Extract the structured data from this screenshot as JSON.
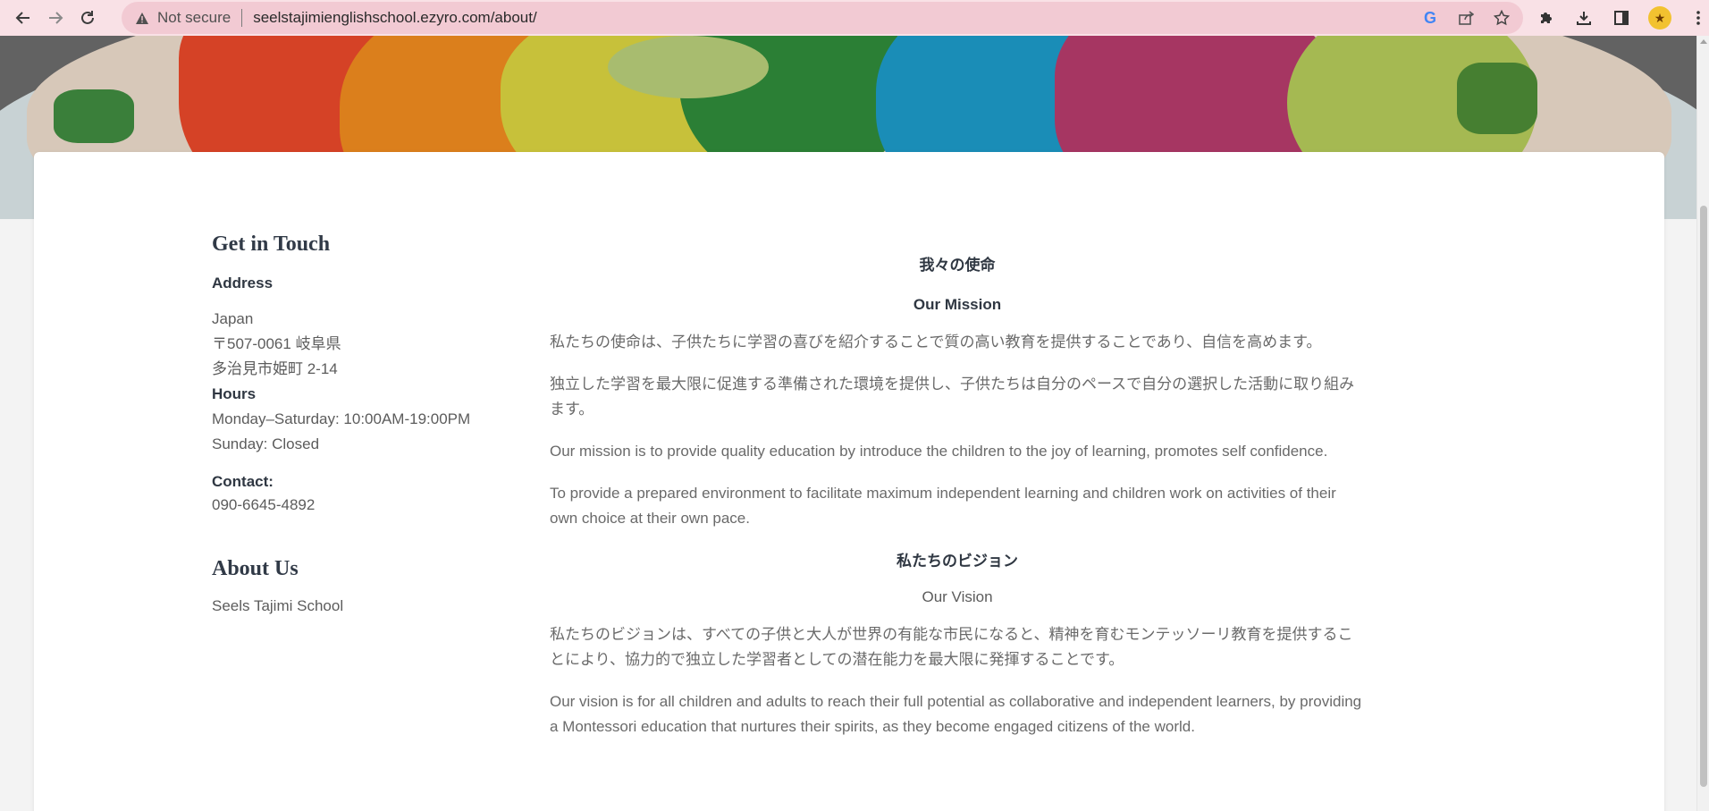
{
  "browser": {
    "not_secure_label": "Not secure",
    "url": "seelstajimienglishschool.ezyro.com/about/",
    "google_g": "G"
  },
  "contact": {
    "title": "Get in Touch",
    "address_label": "Address",
    "address_line1": "Japan",
    "address_line2": "〒507-0061 岐阜県",
    "address_line3": "多治見市姫町 2-14",
    "hours_label": "Hours",
    "hours_weekday": "Monday–Saturday: 10:00AM-19:00PM",
    "hours_sunday": "Sunday: Closed",
    "contact_label": "Contact:",
    "phone": "090-6645-4892"
  },
  "about": {
    "title": "About Us",
    "name": "Seels Tajimi School"
  },
  "mission": {
    "heading_ja": "我々の使命",
    "heading_en": "Our Mission",
    "para1_ja": "私たちの使命は、子供たちに学習の喜びを紹介することで質の高い教育を提供することであり、自信を高めます。",
    "para2_ja": "独立した学習を最大限に促進する準備された環境を提供し、子供たちは自分のペースで自分の選択した活動に取り組みます。",
    "para1_en": "Our mission is to provide quality education by introduce the children to the joy of learning, promotes self confidence.",
    "para2_en": "To provide a prepared environment to facilitate maximum independent learning and children work on activities of their own choice at their own pace."
  },
  "vision": {
    "heading_ja": "私たちのビジョン",
    "heading_en": "Our Vision",
    "para_ja": "私たちのビジョンは、すべての子供と大人が世界の有能な市民になると、精神を育むモンテッソーリ教育を提供することにより、協力的で独立した学習者としての潜在能力を最大限に発揮することです。",
    "para_en": "Our vision is for all children and adults to reach their full potential as collaborative and independent learners, by providing a Montessori education that nurtures their spirits, as they become engaged citizens of the world."
  }
}
